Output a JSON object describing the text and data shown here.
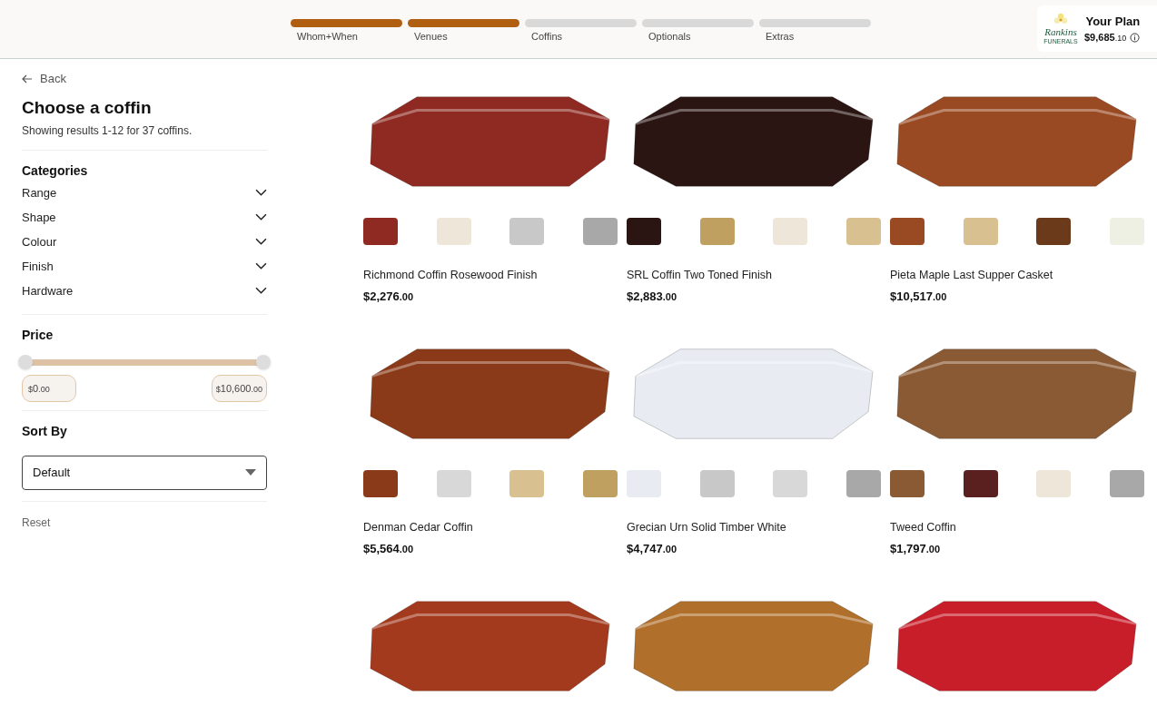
{
  "steps": [
    {
      "label": "Whom+When",
      "done": true
    },
    {
      "label": "Venues",
      "done": true
    },
    {
      "label": "Coffins",
      "done": false
    },
    {
      "label": "Optionals",
      "done": false
    },
    {
      "label": "Extras",
      "done": false
    }
  ],
  "plan": {
    "logo_text": "Rankins",
    "logo_subtext": "FUNERALS",
    "title": "Your Plan",
    "total": "$9,685",
    "total_cents": ".10"
  },
  "sidebar": {
    "back": "Back",
    "title": "Choose a coffin",
    "summary": "Showing results 1-12 for 37 coffins.",
    "categories_title": "Categories",
    "categories": [
      {
        "label": "Range",
        "expanded": false
      },
      {
        "label": "Shape",
        "expanded": false
      },
      {
        "label": "Colour",
        "expanded": false
      },
      {
        "label": "Finish",
        "expanded": false
      },
      {
        "label": "Hardware",
        "expanded": false
      }
    ],
    "price_title": "Price",
    "price_min": {
      "level": 0
    },
    "price_max": {
      "level": 1
    },
    "min_field": {
      "symbol": "$",
      "value": "0",
      "cents": ".00"
    },
    "max_field": {
      "symbol": "$",
      "value": "10,600",
      "cents": ".00"
    },
    "sort_title": "Sort By",
    "sort_value": "Default",
    "reset": "Reset"
  },
  "products": [
    {
      "kind": "full",
      "name": "Richmond Coffin Rosewood Finish",
      "price": "$2,276",
      "cents": ".00"
    },
    {
      "kind": "full",
      "name": "SRL Coffin Two Toned Finish",
      "price": "$2,883",
      "cents": ".00"
    },
    {
      "kind": "full",
      "name": "Pieta Maple Last Supper Casket",
      "price": "$10,517",
      "cents": ".00"
    },
    {
      "kind": "full",
      "name": "Denman Cedar Coffin",
      "price": "$5,564",
      "cents": ".00"
    },
    {
      "kind": "full",
      "name": "Grecian Urn Solid Timber White",
      "price": "$4,747",
      "cents": ".00"
    },
    {
      "kind": "full",
      "name": "Tweed Coffin",
      "price": "$1,797",
      "cents": ".00"
    },
    {
      "kind": "image_only"
    },
    {
      "kind": "image_only"
    },
    {
      "kind": "image_only"
    }
  ]
}
